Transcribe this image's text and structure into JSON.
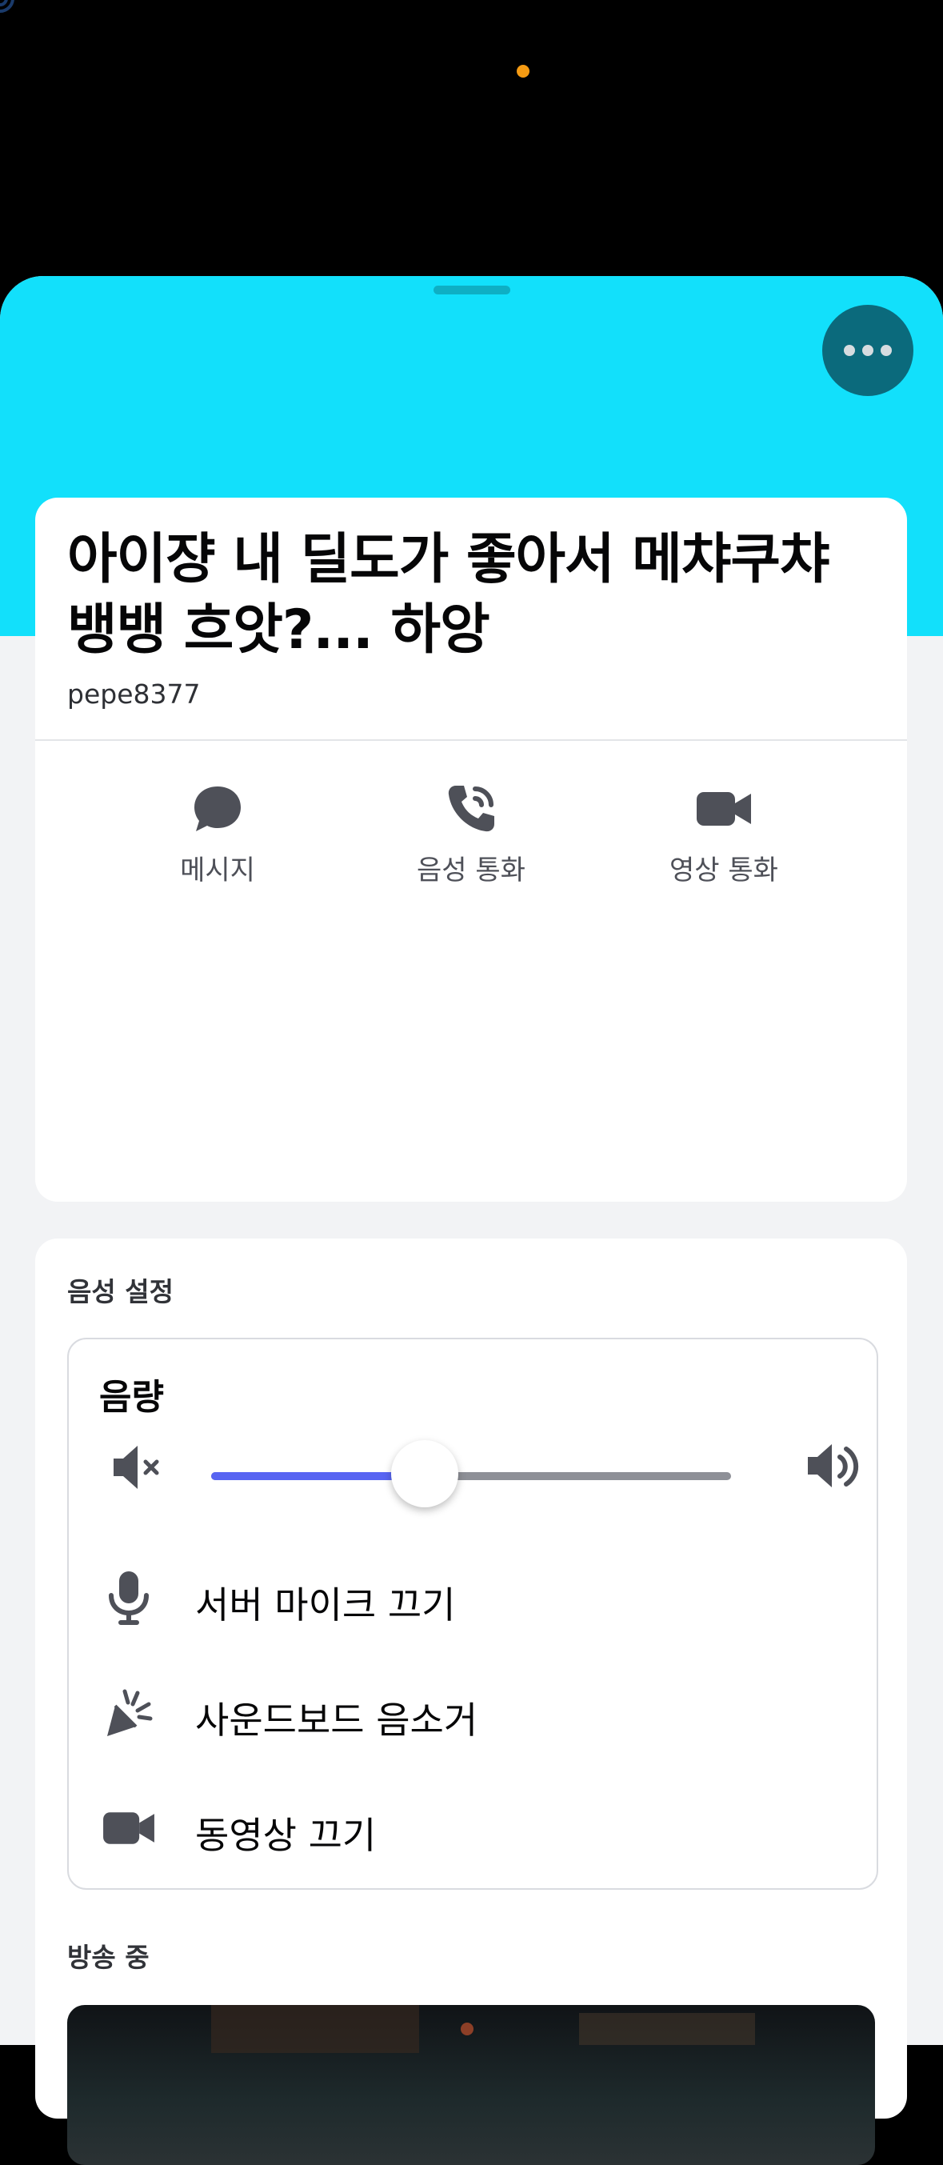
{
  "app": {
    "name": "Discord user profile sheet"
  },
  "colors": {
    "banner": "#12e0fb",
    "more_button": "#0b6a7c",
    "status_offline": "#80848e",
    "hashtag_badge": "#23a579",
    "slider_fill": "#5865f2",
    "slider_track": "#8e9097",
    "camera_indicator": "#f59b13"
  },
  "profile": {
    "display_name": "아이쟝 내 딜도가 좋아서 메챠쿠챠 뱅뱅 흐앗?... 하앙",
    "username": "pepe8377",
    "status": "offline",
    "avatar_icon": "avatar-image",
    "badge_icon": "hashtag-icon"
  },
  "actions": [
    {
      "label": "메시지",
      "icon": "chat-bubble-icon"
    },
    {
      "label": "음성 통화",
      "icon": "phone-call-icon"
    },
    {
      "label": "영상 통화",
      "icon": "video-camera-icon"
    }
  ],
  "voice_settings": {
    "title": "음성 설정",
    "volume_label": "음량",
    "volume_fraction": 0.41,
    "mute_icon": "speaker-muted-icon",
    "loud_icon": "speaker-loud-icon",
    "toggles": [
      {
        "label": "서버 마이크 끄기",
        "icon": "microphone-icon"
      },
      {
        "label": "사운드보드 음소거",
        "icon": "soundboard-icon"
      },
      {
        "label": "동영상 끄기",
        "icon": "video-camera-icon"
      }
    ]
  },
  "streaming": {
    "title": "방송 중"
  }
}
